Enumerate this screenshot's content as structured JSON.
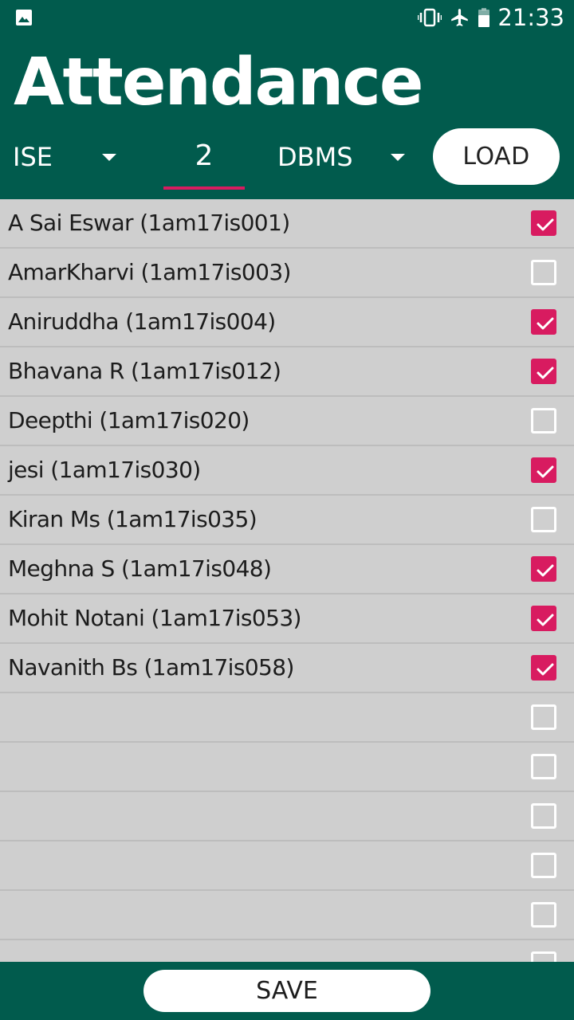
{
  "status_bar": {
    "time": "21:33",
    "icons": [
      "image-icon",
      "vibrate-icon",
      "airplane-icon",
      "battery-icon"
    ]
  },
  "header": {
    "title": "Attendance"
  },
  "filters": {
    "branch": "ISE",
    "semester": "2",
    "subject": "DBMS",
    "load_label": "LOAD"
  },
  "students": [
    {
      "label": "A Sai Eswar (1am17is001)",
      "checked": true
    },
    {
      "label": "AmarKharvi (1am17is003)",
      "checked": false
    },
    {
      "label": "Aniruddha (1am17is004)",
      "checked": true
    },
    {
      "label": "Bhavana R (1am17is012)",
      "checked": true
    },
    {
      "label": "Deepthi (1am17is020)",
      "checked": false
    },
    {
      "label": "jesi (1am17is030)",
      "checked": true
    },
    {
      "label": "Kiran Ms (1am17is035)",
      "checked": false
    },
    {
      "label": "Meghna S (1am17is048)",
      "checked": true
    },
    {
      "label": "Mohit Notani (1am17is053)",
      "checked": true
    },
    {
      "label": "Navanith Bs (1am17is058)",
      "checked": true
    },
    {
      "label": "",
      "checked": false
    },
    {
      "label": "",
      "checked": false
    },
    {
      "label": "",
      "checked": false
    },
    {
      "label": "",
      "checked": false
    },
    {
      "label": "",
      "checked": false
    },
    {
      "label": "",
      "checked": false
    }
  ],
  "footer": {
    "save_label": "SAVE"
  },
  "colors": {
    "header_bg": "#015b4d",
    "accent": "#d81b60",
    "list_bg": "#cfcfcf"
  }
}
